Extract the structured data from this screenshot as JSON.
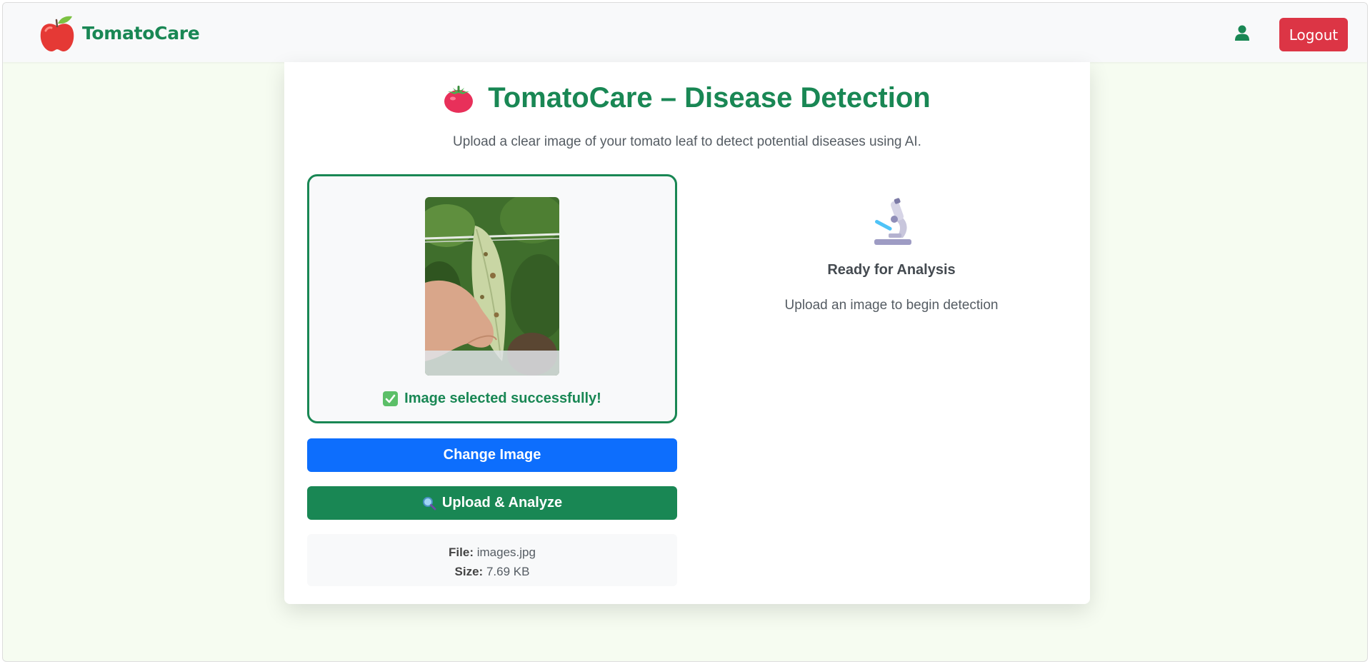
{
  "navbar": {
    "brand_name": "TomatoCare",
    "logout_label": "Logout"
  },
  "main": {
    "title": "TomatoCare – Disease Detection",
    "subtitle": "Upload a clear image of your tomato leaf to detect potential diseases using AI.",
    "preview": {
      "status": "Image selected successfully!"
    },
    "change_label": "Change Image",
    "analyze_label": "Upload & Analyze",
    "file": {
      "file_label": "File:",
      "file_name": "images.jpg",
      "size_label": "Size:",
      "size_value": "7.69 KB"
    },
    "result": {
      "title": "Ready for Analysis",
      "subtitle": "Upload an image to begin detection"
    }
  },
  "colors": {
    "brand_green": "#198754",
    "primary_blue": "#0d6efd",
    "danger_red": "#dc3545",
    "page_bg": "#f6fcf1"
  },
  "icons": [
    "apple-logo-icon",
    "user-icon",
    "tomato-icon",
    "check-icon",
    "magnifier-icon",
    "microscope-icon"
  ]
}
